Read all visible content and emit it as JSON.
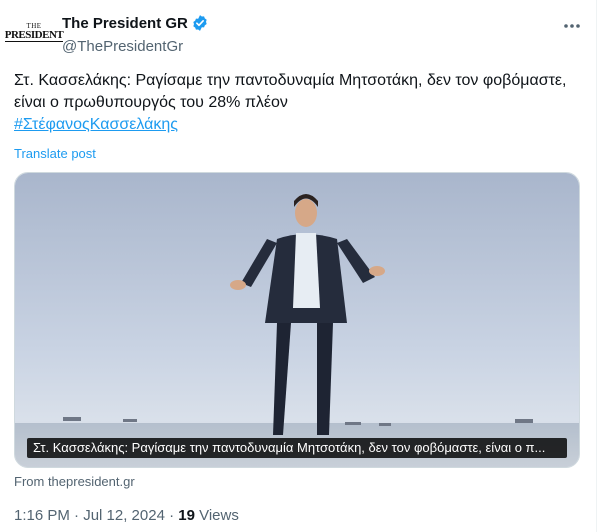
{
  "author": {
    "display_name": "The President GR",
    "handle": "@ThePresidentGr",
    "avatar_text_top": "THE",
    "avatar_text_bottom": "PRESIDENT",
    "verified_color": "#1d9bf0"
  },
  "tweet": {
    "text": "Στ. Κασσελάκης: Ραγίσαμε την παντοδυναμία Μητσοτάκη, δεν τον φοβόμαστε, είναι ο πρωθυπουργός του 28% πλέον",
    "hashtag": "#ΣτέφανοςΚασσελάκης",
    "translate_label": "Translate post"
  },
  "card": {
    "title": "Στ. Κασσελάκης: Ραγίσαμε την παντοδυναμία Μητσοτάκη, δεν τον φοβόμαστε, είναι ο π...",
    "source": "From thepresident.gr"
  },
  "meta": {
    "time_date": "1:16 PM · Jul 12, 2024 · ",
    "views_count": "19",
    "views_label": " Views"
  },
  "icons": {
    "more": "more-icon",
    "verified": "verified-badge-icon"
  },
  "colors": {
    "link": "#1d9bf0",
    "secondary_text": "#536471",
    "primary_text": "#0f1419"
  }
}
